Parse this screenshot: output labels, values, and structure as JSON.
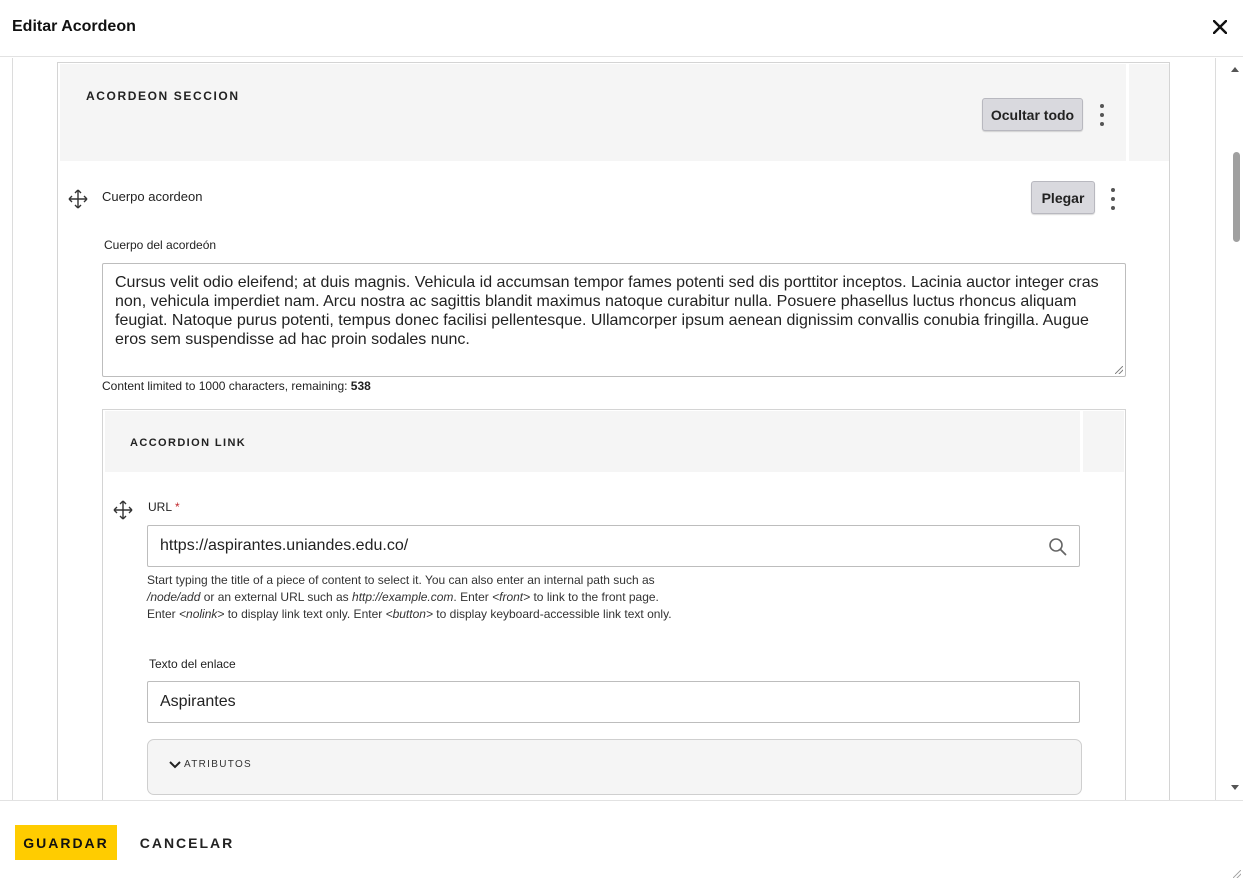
{
  "dialog": {
    "title": "Editar Acordeon",
    "close_icon": "close-icon"
  },
  "section": {
    "title": "ACORDEON SECCION",
    "hide_all_label": "Ocultar todo"
  },
  "body_item": {
    "title": "Cuerpo acordeon",
    "collapse_label": "Plegar",
    "field_label": "Cuerpo del acordeón",
    "text": "Cursus velit odio eleifend; at duis magnis. Vehicula id accumsan tempor fames potenti sed dis porttitor inceptos. Lacinia auctor integer cras non, vehicula imperdiet nam. Arcu nostra ac sagittis blandit maximus natoque curabitur nulla. Posuere phasellus luctus rhoncus aliquam feugiat. Natoque purus potenti, tempus donec facilisi pellentesque. Ullamcorper ipsum aenean dignissim convallis conubia fringilla. Augue eros sem suspendisse ad hac proin sodales nunc.",
    "limit_text": "Content limited to 1000 characters, remaining: ",
    "limit_remaining": "538"
  },
  "link": {
    "section_title": "ACCORDION LINK",
    "url_label": "URL",
    "required_mark": "*",
    "url_value": "https://aspirantes.uniandes.edu.co/",
    "help": {
      "p1": "Start typing the title of a piece of content to select it. You can also enter an internal path such as ",
      "node_add": "/node/add",
      "p2": " or an external URL such as ",
      "example": "http://example.com",
      "p3": ". Enter ",
      "front": "<front>",
      "p4": " to link to the front page. Enter ",
      "nolink": "<nolink>",
      "p5": " to display link text only. Enter ",
      "button": "<button>",
      "p6": " to display keyboard-accessible link text only."
    },
    "text_label": "Texto del enlace",
    "text_value": "Aspirantes",
    "attributes_label": "ATRIBUTOS"
  },
  "footer": {
    "save_label": "GUARDAR",
    "cancel_label": "CANCELAR"
  },
  "colors": {
    "accent": "#ffcc00",
    "required": "#c0282d",
    "panel_bg": "#f5f5f5"
  }
}
